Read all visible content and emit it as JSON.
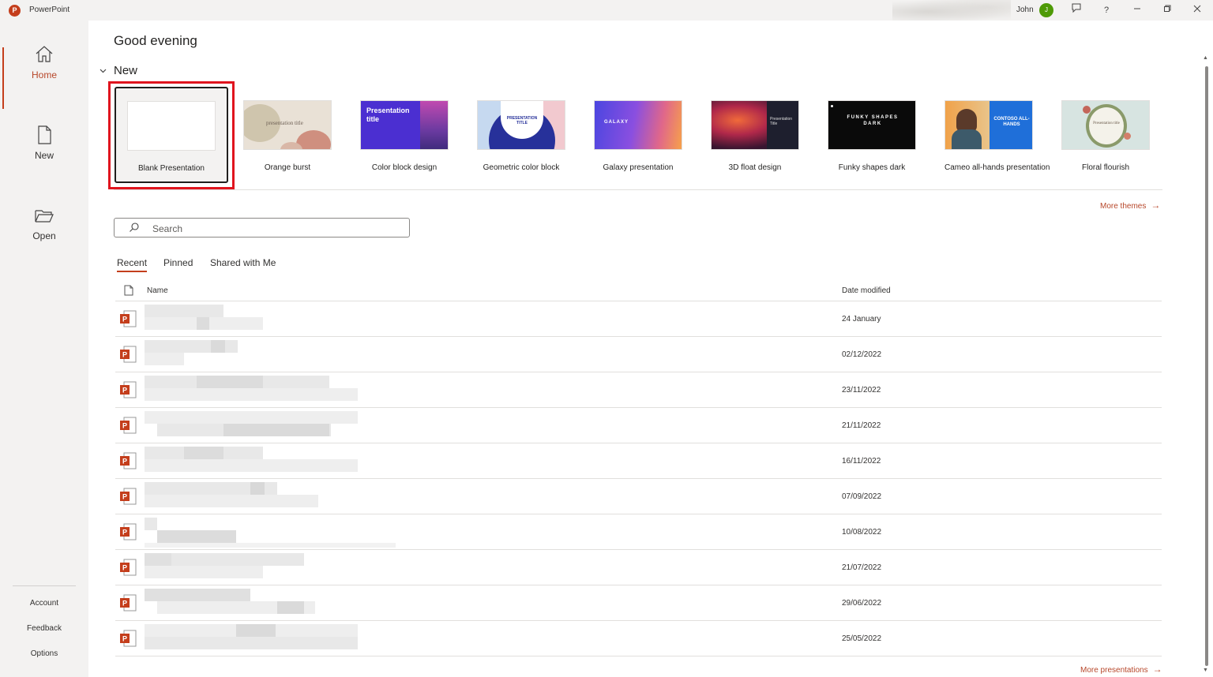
{
  "app": {
    "title": "PowerPoint",
    "logo_letter": "P"
  },
  "titlebar": {
    "user_name": "John",
    "user_initial": "J",
    "icons": [
      "feedback-icon",
      "help-icon",
      "minimize-icon",
      "restore-icon",
      "close-icon"
    ],
    "help_label": "?"
  },
  "nav": {
    "home": "Home",
    "new": "New",
    "open": "Open",
    "account": "Account",
    "feedback": "Feedback",
    "options": "Options"
  },
  "greeting": "Good evening",
  "new_section": {
    "header": "New",
    "blank_label": "Blank Presentation",
    "templates": [
      {
        "name": "Orange burst",
        "thumb_text": "presentation title"
      },
      {
        "name": "Color block design",
        "thumb_text": "Presentation title"
      },
      {
        "name": "Geometric color block",
        "thumb_text": "PRESENTATION TITLE"
      },
      {
        "name": "Galaxy presentation",
        "thumb_text": "GALAXY"
      },
      {
        "name": "3D float design",
        "thumb_text": "Presentation Title"
      },
      {
        "name": "Funky shapes dark",
        "thumb_text": "FUNKY SHAPES DARK"
      },
      {
        "name": "Cameo all-hands presentation",
        "thumb_text": "CONTOSO ALL-HANDS"
      },
      {
        "name": "Floral flourish",
        "thumb_text": "Presentation title"
      }
    ],
    "more_themes": "More themes"
  },
  "search": {
    "placeholder": "Search"
  },
  "tabs": [
    "Recent",
    "Pinned",
    "Shared with Me"
  ],
  "file_list": {
    "col_name": "Name",
    "col_date": "Date modified",
    "rows": [
      {
        "date": "24 January"
      },
      {
        "date": "02/12/2022"
      },
      {
        "date": "23/11/2022"
      },
      {
        "date": "21/11/2022"
      },
      {
        "date": "16/11/2022"
      },
      {
        "date": "07/09/2022"
      },
      {
        "date": "10/08/2022"
      },
      {
        "date": "21/07/2022"
      },
      {
        "date": "29/06/2022"
      },
      {
        "date": "25/05/2022"
      }
    ],
    "more_presentations": "More presentations"
  },
  "colors": {
    "accent": "#c43e1c",
    "accent_text": "#b7472a",
    "highlight": "#e0141e"
  }
}
